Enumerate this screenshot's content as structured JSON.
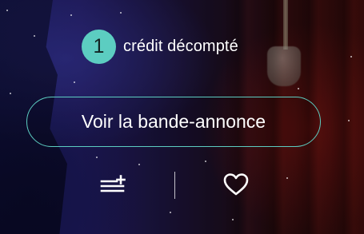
{
  "credit": {
    "count": "1",
    "label": "crédit décompté"
  },
  "trailer_button": {
    "label": "Voir la bande-annonce"
  },
  "actions": {
    "add_to_list_icon": "playlist-add-icon",
    "favorite_icon": "heart-outline-icon"
  },
  "colors": {
    "accent": "#5ccdc1",
    "text": "#ffffff"
  }
}
